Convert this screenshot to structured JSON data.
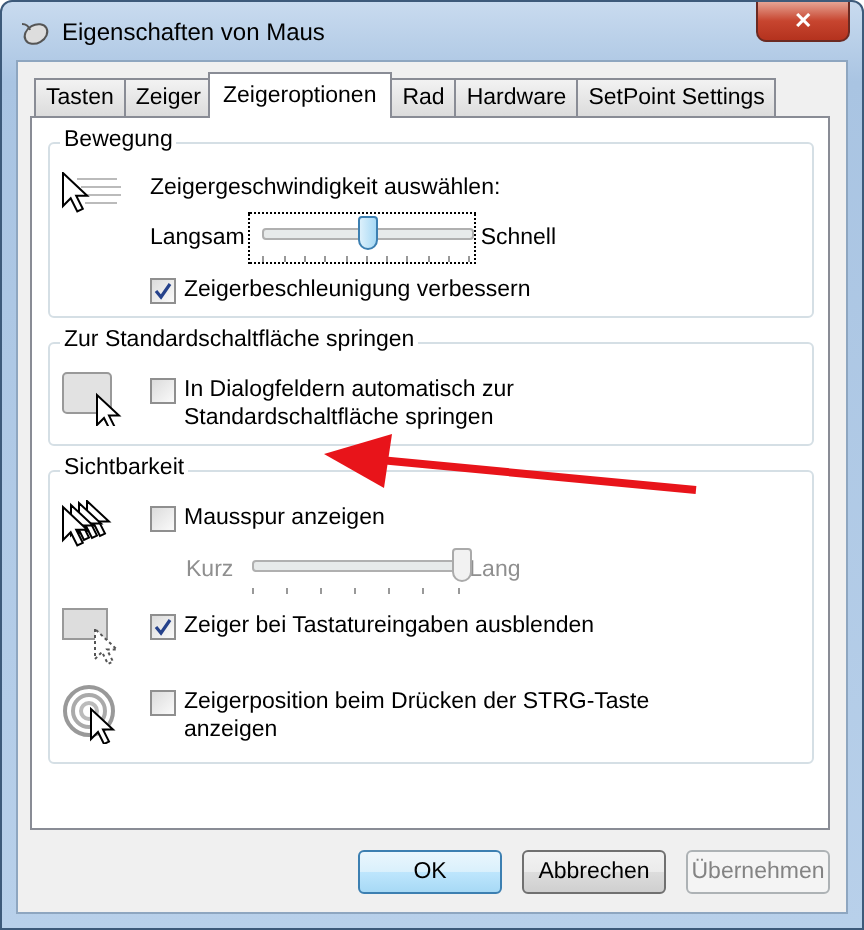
{
  "window": {
    "title": "Eigenschaften von Maus",
    "close": "✕"
  },
  "tabs": [
    {
      "label": "Tasten",
      "selected": false
    },
    {
      "label": "Zeiger",
      "selected": false
    },
    {
      "label": "Zeigeroptionen",
      "selected": true
    },
    {
      "label": "Rad",
      "selected": false
    },
    {
      "label": "Hardware",
      "selected": false
    },
    {
      "label": "SetPoint Settings",
      "selected": false
    }
  ],
  "groups": [
    {
      "title": "Bewegung",
      "rows": [
        {
          "controls": [
            {
              "kind": "label",
              "text": "Zeigergeschwindigkeit auswählen:"
            },
            {
              "kind": "slider",
              "min_label": "Langsam",
              "max_label": "Schnell",
              "level": 0.5,
              "disabled": false,
              "focused": true
            },
            {
              "kind": "checkbox",
              "label": "Zeigerbeschleunigung verbessern",
              "checked": true
            }
          ]
        }
      ]
    },
    {
      "title": "Zur Standardschaltfläche springen",
      "rows": [
        {
          "controls": [
            {
              "kind": "checkbox",
              "label": "In Dialogfeldern automatisch zur Standardschaltfläche springen",
              "checked": false
            }
          ]
        }
      ]
    },
    {
      "title": "Sichtbarkeit",
      "rows": [
        {
          "controls": [
            {
              "kind": "checkbox",
              "label": "Mausspur anzeigen",
              "checked": false
            },
            {
              "kind": "slider",
              "min_label": "Kurz",
              "max_label": "Lang",
              "level": 1.0,
              "disabled": true,
              "focused": false
            }
          ]
        },
        {
          "controls": [
            {
              "kind": "checkbox",
              "label": "Zeiger bei Tastatureingaben ausblenden",
              "checked": true
            }
          ]
        },
        {
          "controls": [
            {
              "kind": "checkbox",
              "label": "Zeigerposition beim Drücken der STRG-Taste anzeigen",
              "checked": false
            }
          ]
        }
      ]
    }
  ],
  "buttons": [
    {
      "label": "OK",
      "default": true,
      "disabled": false
    },
    {
      "label": "Abbrechen",
      "default": false,
      "disabled": false
    },
    {
      "label": "Übernehmen",
      "default": false,
      "disabled": true
    }
  ]
}
